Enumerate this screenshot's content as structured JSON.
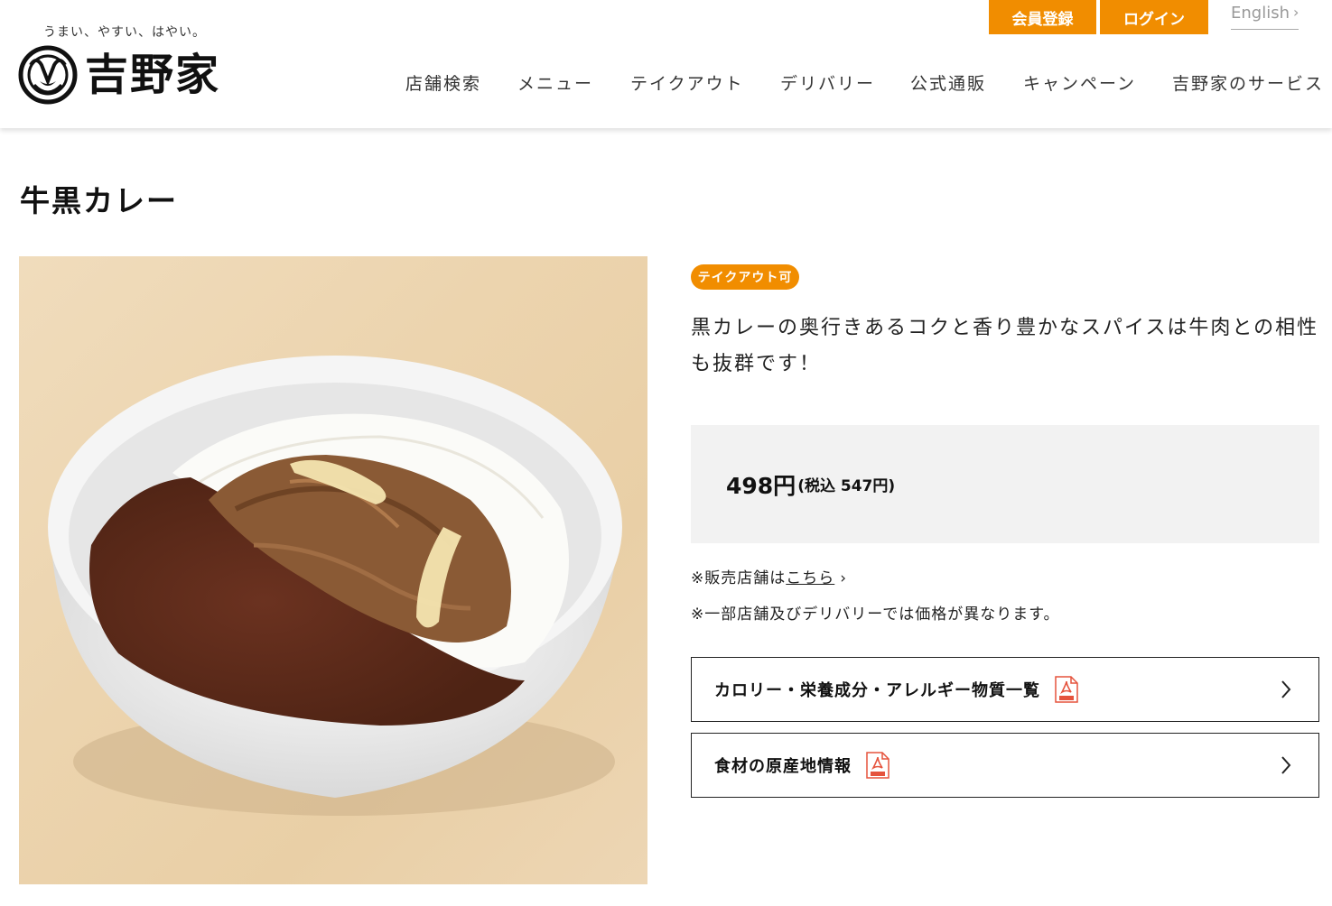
{
  "header": {
    "tagline": "うまい、やすい、はやい。",
    "logo_text": "吉野家",
    "register_label": "会員登録",
    "login_label": "ログイン",
    "english_label": "English",
    "nav": [
      "店舗検索",
      "メニュー",
      "テイクアウト",
      "デリバリー",
      "公式通販",
      "キャンペーン",
      "吉野家のサービス"
    ]
  },
  "product": {
    "title": "牛黒カレー",
    "badge": "テイクアウト可",
    "description": "黒カレーの奥行きあるコクと香り豊かなスパイスは牛肉との相性も抜群です！",
    "price": "498円",
    "price_tax": "(税込 547円)",
    "store_note_prefix": "※販売店舗は",
    "store_note_link": "こちら",
    "price_note": "※一部店舗及びデリバリーでは価格が異なります。",
    "links": [
      {
        "label": "カロリー・栄養成分・アレルギー物質一覧"
      },
      {
        "label": "食材の原産地情報"
      }
    ]
  },
  "colors": {
    "accent": "#f18d00",
    "price_bg": "#f2f2f2"
  },
  "icons": {
    "pdf": "pdf-icon",
    "chevron": "chevron-right-icon"
  }
}
